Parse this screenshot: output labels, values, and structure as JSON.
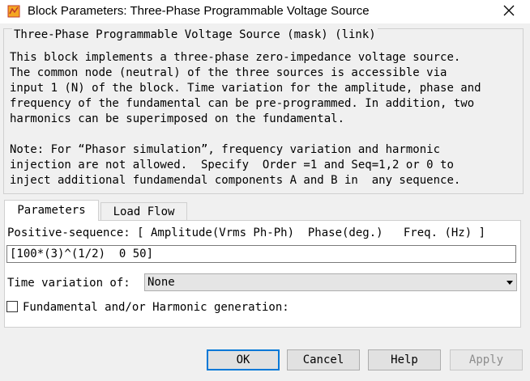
{
  "window": {
    "title": "Block Parameters: Three-Phase Programmable Voltage Source",
    "close_icon": "close-icon",
    "app_icon": "simulink-block-icon"
  },
  "mask": {
    "title": "Three-Phase Programmable Voltage Source (mask) (link)",
    "description_lines": [
      "This block implements a three-phase zero-impedance voltage source.",
      "The common node (neutral) of the three sources is accessible via",
      "input 1 (N) of the block. Time variation for the amplitude, phase and",
      "frequency of the fundamental can be pre-programmed. In addition, two",
      "harmonics can be superimposed on the fundamental.",
      "Note: For “Phasor simulation”, frequency variation and harmonic",
      "injection are not allowed.  Specify  Order =1 and Seq=1,2 or 0 to",
      "inject additional fundamendal components A and B in  any sequence."
    ]
  },
  "tabs": [
    {
      "label": "Parameters",
      "active": true
    },
    {
      "label": "Load Flow",
      "active": false
    }
  ],
  "parameters": {
    "positive_sequence_label": "Positive-sequence: [ Amplitude(Vrms Ph-Ph)  Phase(deg.)   Freq. (Hz) ]",
    "positive_sequence_value": "[100*(3)^(1/2)  0 50]",
    "time_variation_label": "Time variation of:",
    "time_variation_value": "None",
    "fundamental_harmonic_label": "Fundamental and/or Harmonic generation:",
    "fundamental_harmonic_checked": false
  },
  "buttons": {
    "ok": "OK",
    "cancel": "Cancel",
    "help": "Help",
    "apply": "Apply"
  },
  "colors": {
    "ok_focus_border": "#0078d7",
    "window_background": "#f0f0f0",
    "disabled_text": "#8d8d8d"
  }
}
